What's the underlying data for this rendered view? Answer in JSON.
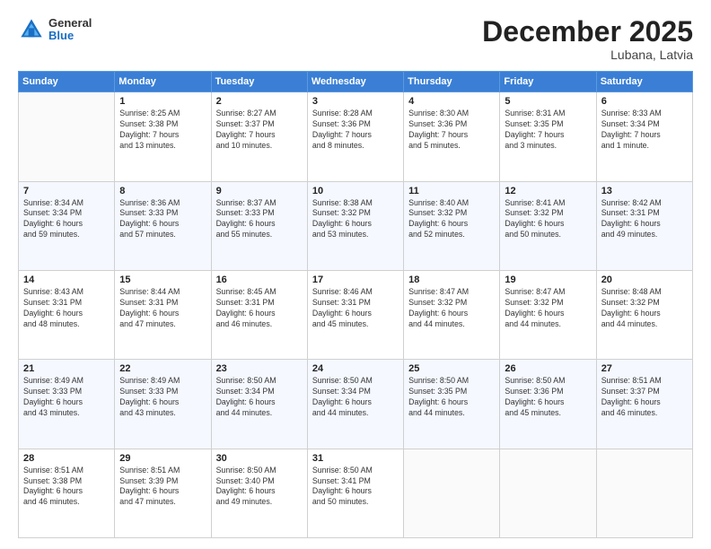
{
  "header": {
    "logo": {
      "general": "General",
      "blue": "Blue"
    },
    "title": "December 2025",
    "location": "Lubana, Latvia"
  },
  "weekdays": [
    "Sunday",
    "Monday",
    "Tuesday",
    "Wednesday",
    "Thursday",
    "Friday",
    "Saturday"
  ],
  "weeks": [
    [
      {
        "day": "",
        "info": ""
      },
      {
        "day": "1",
        "info": "Sunrise: 8:25 AM\nSunset: 3:38 PM\nDaylight: 7 hours\nand 13 minutes."
      },
      {
        "day": "2",
        "info": "Sunrise: 8:27 AM\nSunset: 3:37 PM\nDaylight: 7 hours\nand 10 minutes."
      },
      {
        "day": "3",
        "info": "Sunrise: 8:28 AM\nSunset: 3:36 PM\nDaylight: 7 hours\nand 8 minutes."
      },
      {
        "day": "4",
        "info": "Sunrise: 8:30 AM\nSunset: 3:36 PM\nDaylight: 7 hours\nand 5 minutes."
      },
      {
        "day": "5",
        "info": "Sunrise: 8:31 AM\nSunset: 3:35 PM\nDaylight: 7 hours\nand 3 minutes."
      },
      {
        "day": "6",
        "info": "Sunrise: 8:33 AM\nSunset: 3:34 PM\nDaylight: 7 hours\nand 1 minute."
      }
    ],
    [
      {
        "day": "7",
        "info": "Sunrise: 8:34 AM\nSunset: 3:34 PM\nDaylight: 6 hours\nand 59 minutes."
      },
      {
        "day": "8",
        "info": "Sunrise: 8:36 AM\nSunset: 3:33 PM\nDaylight: 6 hours\nand 57 minutes."
      },
      {
        "day": "9",
        "info": "Sunrise: 8:37 AM\nSunset: 3:33 PM\nDaylight: 6 hours\nand 55 minutes."
      },
      {
        "day": "10",
        "info": "Sunrise: 8:38 AM\nSunset: 3:32 PM\nDaylight: 6 hours\nand 53 minutes."
      },
      {
        "day": "11",
        "info": "Sunrise: 8:40 AM\nSunset: 3:32 PM\nDaylight: 6 hours\nand 52 minutes."
      },
      {
        "day": "12",
        "info": "Sunrise: 8:41 AM\nSunset: 3:32 PM\nDaylight: 6 hours\nand 50 minutes."
      },
      {
        "day": "13",
        "info": "Sunrise: 8:42 AM\nSunset: 3:31 PM\nDaylight: 6 hours\nand 49 minutes."
      }
    ],
    [
      {
        "day": "14",
        "info": "Sunrise: 8:43 AM\nSunset: 3:31 PM\nDaylight: 6 hours\nand 48 minutes."
      },
      {
        "day": "15",
        "info": "Sunrise: 8:44 AM\nSunset: 3:31 PM\nDaylight: 6 hours\nand 47 minutes."
      },
      {
        "day": "16",
        "info": "Sunrise: 8:45 AM\nSunset: 3:31 PM\nDaylight: 6 hours\nand 46 minutes."
      },
      {
        "day": "17",
        "info": "Sunrise: 8:46 AM\nSunset: 3:31 PM\nDaylight: 6 hours\nand 45 minutes."
      },
      {
        "day": "18",
        "info": "Sunrise: 8:47 AM\nSunset: 3:32 PM\nDaylight: 6 hours\nand 44 minutes."
      },
      {
        "day": "19",
        "info": "Sunrise: 8:47 AM\nSunset: 3:32 PM\nDaylight: 6 hours\nand 44 minutes."
      },
      {
        "day": "20",
        "info": "Sunrise: 8:48 AM\nSunset: 3:32 PM\nDaylight: 6 hours\nand 44 minutes."
      }
    ],
    [
      {
        "day": "21",
        "info": "Sunrise: 8:49 AM\nSunset: 3:33 PM\nDaylight: 6 hours\nand 43 minutes."
      },
      {
        "day": "22",
        "info": "Sunrise: 8:49 AM\nSunset: 3:33 PM\nDaylight: 6 hours\nand 43 minutes."
      },
      {
        "day": "23",
        "info": "Sunrise: 8:50 AM\nSunset: 3:34 PM\nDaylight: 6 hours\nand 44 minutes."
      },
      {
        "day": "24",
        "info": "Sunrise: 8:50 AM\nSunset: 3:34 PM\nDaylight: 6 hours\nand 44 minutes."
      },
      {
        "day": "25",
        "info": "Sunrise: 8:50 AM\nSunset: 3:35 PM\nDaylight: 6 hours\nand 44 minutes."
      },
      {
        "day": "26",
        "info": "Sunrise: 8:50 AM\nSunset: 3:36 PM\nDaylight: 6 hours\nand 45 minutes."
      },
      {
        "day": "27",
        "info": "Sunrise: 8:51 AM\nSunset: 3:37 PM\nDaylight: 6 hours\nand 46 minutes."
      }
    ],
    [
      {
        "day": "28",
        "info": "Sunrise: 8:51 AM\nSunset: 3:38 PM\nDaylight: 6 hours\nand 46 minutes."
      },
      {
        "day": "29",
        "info": "Sunrise: 8:51 AM\nSunset: 3:39 PM\nDaylight: 6 hours\nand 47 minutes."
      },
      {
        "day": "30",
        "info": "Sunrise: 8:50 AM\nSunset: 3:40 PM\nDaylight: 6 hours\nand 49 minutes."
      },
      {
        "day": "31",
        "info": "Sunrise: 8:50 AM\nSunset: 3:41 PM\nDaylight: 6 hours\nand 50 minutes."
      },
      {
        "day": "",
        "info": ""
      },
      {
        "day": "",
        "info": ""
      },
      {
        "day": "",
        "info": ""
      }
    ]
  ]
}
